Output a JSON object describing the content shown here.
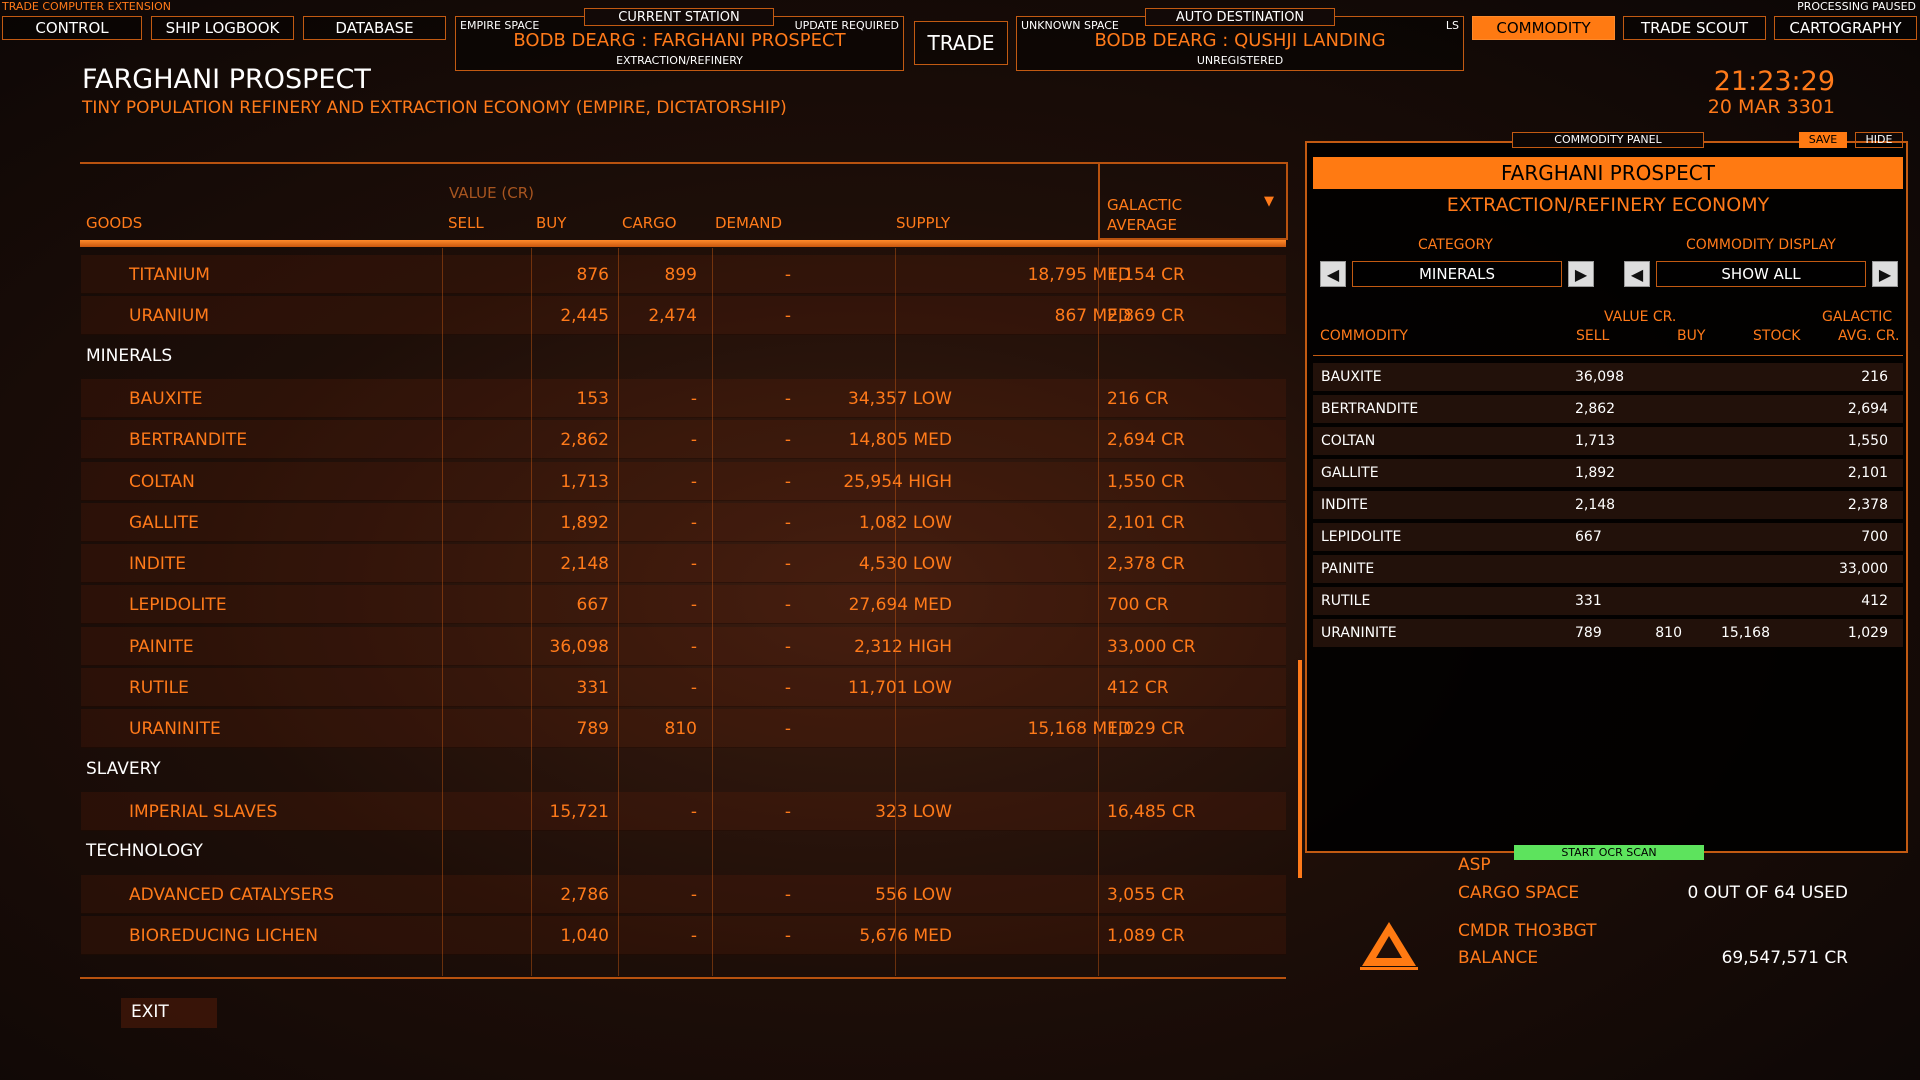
{
  "corner": {
    "left": "TRADE COMPUTER EXTENSION",
    "right": "PROCESSING PAUSED"
  },
  "nav": {
    "control": "CONTROL",
    "logbook": "SHIP LOGBOOK",
    "database": "DATABASE",
    "trade": "TRADE",
    "commodity": "COMMODITY",
    "trade_scout": "TRADE SCOUT",
    "cartography": "CARTOGRAPHY"
  },
  "current_station": {
    "tab": "CURRENT STATION",
    "left": "EMPIRE SPACE",
    "right": "UPDATE REQUIRED",
    "name": "BODB DEARG : FARGHANI PROSPECT",
    "sub": "EXTRACTION/REFINERY"
  },
  "auto_destination": {
    "tab": "AUTO DESTINATION",
    "left": "UNKNOWN SPACE",
    "right": "LS",
    "name": "BODB DEARG : QUSHJI LANDING",
    "sub": "UNREGISTERED"
  },
  "station": {
    "title": "FARGHANI PROSPECT",
    "subtitle": "TINY POPULATION REFINERY AND EXTRACTION ECONOMY (EMPIRE, DICTATORSHIP)"
  },
  "clock": {
    "time": "21:23:29",
    "date": "20 MAR 3301"
  },
  "table": {
    "value_label": "VALUE (CR)",
    "headers": {
      "goods": "GOODS",
      "sell": "SELL",
      "buy": "BUY",
      "cargo": "CARGO",
      "demand": "DEMAND",
      "supply": "SUPPLY",
      "galactic": "GALACTIC",
      "average": "AVERAGE"
    },
    "rows_top": [
      {
        "name": "TITANIUM",
        "sell": "876",
        "buy": "899",
        "cargo": "-",
        "demand": "",
        "supply": "18,795 MED",
        "avg": "1,154 CR"
      },
      {
        "name": "URANIUM",
        "sell": "2,445",
        "buy": "2,474",
        "cargo": "-",
        "demand": "",
        "supply": "867 MED",
        "avg": "2,869 CR"
      }
    ],
    "cat_minerals": "MINERALS",
    "minerals": [
      {
        "name": "BAUXITE",
        "sell": "153",
        "buy": "-",
        "cargo": "-",
        "demand": "34,357 LOW",
        "supply": "",
        "avg": "216 CR"
      },
      {
        "name": "BERTRANDITE",
        "sell": "2,862",
        "buy": "-",
        "cargo": "-",
        "demand": "14,805 MED",
        "supply": "",
        "avg": "2,694 CR"
      },
      {
        "name": "COLTAN",
        "sell": "1,713",
        "buy": "-",
        "cargo": "-",
        "demand": "25,954 HIGH",
        "supply": "",
        "avg": "1,550 CR"
      },
      {
        "name": "GALLITE",
        "sell": "1,892",
        "buy": "-",
        "cargo": "-",
        "demand": "1,082 LOW",
        "supply": "",
        "avg": "2,101 CR"
      },
      {
        "name": "INDITE",
        "sell": "2,148",
        "buy": "-",
        "cargo": "-",
        "demand": "4,530 LOW",
        "supply": "",
        "avg": "2,378 CR"
      },
      {
        "name": "LEPIDOLITE",
        "sell": "667",
        "buy": "-",
        "cargo": "-",
        "demand": "27,694 MED",
        "supply": "",
        "avg": "700 CR"
      },
      {
        "name": "PAINITE",
        "sell": "36,098",
        "buy": "-",
        "cargo": "-",
        "demand": "2,312 HIGH",
        "supply": "",
        "avg": "33,000 CR"
      },
      {
        "name": "RUTILE",
        "sell": "331",
        "buy": "-",
        "cargo": "-",
        "demand": "11,701 LOW",
        "supply": "",
        "avg": "412 CR"
      },
      {
        "name": "URANINITE",
        "sell": "789",
        "buy": "810",
        "cargo": "-",
        "demand": "",
        "supply": "15,168 MED",
        "avg": "1,029 CR"
      }
    ],
    "cat_slavery": "SLAVERY",
    "slavery": [
      {
        "name": "IMPERIAL SLAVES",
        "sell": "15,721",
        "buy": "-",
        "cargo": "-",
        "demand": "323 LOW",
        "supply": "",
        "avg": "16,485 CR"
      }
    ],
    "cat_technology": "TECHNOLOGY",
    "technology": [
      {
        "name": "ADVANCED CATALYSERS",
        "sell": "2,786",
        "buy": "-",
        "cargo": "-",
        "demand": "556 LOW",
        "supply": "",
        "avg": "3,055 CR"
      },
      {
        "name": "BIOREDUCING LICHEN",
        "sell": "1,040",
        "buy": "-",
        "cargo": "-",
        "demand": "5,676 MED",
        "supply": "",
        "avg": "1,089 CR"
      }
    ]
  },
  "exit_label": "EXIT",
  "panel": {
    "tab": "COMMODITY PANEL",
    "save": "SAVE",
    "hide": "HIDE",
    "station": "FARGHANI PROSPECT",
    "economy": "EXTRACTION/REFINERY ECONOMY",
    "category_label": "CATEGORY",
    "category_value": "MINERALS",
    "display_label": "COMMODITY DISPLAY",
    "display_value": "SHOW ALL",
    "h_commodity": "COMMODITY",
    "h_value": "VALUE CR.",
    "h_sell": "SELL",
    "h_buy": "BUY",
    "h_stock": "STOCK",
    "h_galactic": "GALACTIC",
    "h_avg": "AVG. CR.",
    "rows": [
      {
        "name": "BAUXITE",
        "sell": "36,098",
        "buy": "",
        "stock": "",
        "avg": "216"
      },
      {
        "name": "BERTRANDITE",
        "sell": "2,862",
        "buy": "",
        "stock": "",
        "avg": "2,694"
      },
      {
        "name": "COLTAN",
        "sell": "1,713",
        "buy": "",
        "stock": "",
        "avg": "1,550"
      },
      {
        "name": "GALLITE",
        "sell": "1,892",
        "buy": "",
        "stock": "",
        "avg": "2,101"
      },
      {
        "name": "INDITE",
        "sell": "2,148",
        "buy": "",
        "stock": "",
        "avg": "2,378"
      },
      {
        "name": "LEPIDOLITE",
        "sell": "667",
        "buy": "",
        "stock": "",
        "avg": "700"
      },
      {
        "name": "PAINITE",
        "sell": "",
        "buy": "",
        "stock": "",
        "avg": "33,000"
      },
      {
        "name": "RUTILE",
        "sell": "331",
        "buy": "",
        "stock": "",
        "avg": "412"
      },
      {
        "name": "URANINITE",
        "sell": "789",
        "buy": "810",
        "stock": "15,168",
        "avg": "1,029"
      }
    ],
    "ocr_button": "START OCR SCAN"
  },
  "ship": {
    "name": "ASP",
    "cargo_label": "CARGO SPACE",
    "cargo_value": "0 OUT OF 64 USED",
    "cmdr": "CMDR THO3BGT",
    "balance_label": "BALANCE",
    "balance_value": "69,547,571 CR"
  },
  "colors": {
    "accent": "#ff7a12",
    "ocr_green": "#5de35d"
  }
}
